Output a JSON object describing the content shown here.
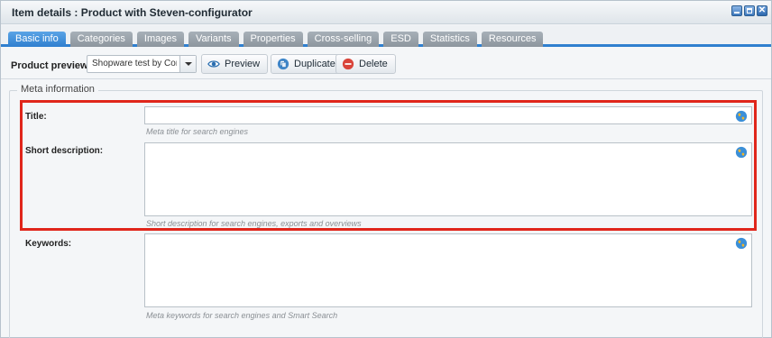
{
  "window": {
    "title": "Item details : Product with Steven-configurator",
    "buttons": [
      "minimize-button",
      "maximize-button",
      "close-button"
    ]
  },
  "tabs": [
    {
      "label": "Basic info",
      "active": true
    },
    {
      "label": "Categories",
      "active": false
    },
    {
      "label": "Images",
      "active": false
    },
    {
      "label": "Variants",
      "active": false
    },
    {
      "label": "Properties",
      "active": false
    },
    {
      "label": "Cross-selling",
      "active": false
    },
    {
      "label": "ESD",
      "active": false
    },
    {
      "label": "Statistics",
      "active": false
    },
    {
      "label": "Resources",
      "active": false
    }
  ],
  "toolbar": {
    "preview_label": "Product preview:",
    "shop_select_value": "Shopware test by Conte",
    "preview_button": "Preview",
    "duplicate_button": "Duplicate",
    "delete_button": "Delete"
  },
  "meta": {
    "legend": "Meta information",
    "fields": [
      {
        "label": "Title:",
        "value": "",
        "hint": "Meta title for search engines"
      },
      {
        "label": "Short description:",
        "value": "",
        "hint": "Short description for search engines, exports and overviews"
      },
      {
        "label": "Keywords:",
        "value": "",
        "hint": "Meta keywords for search engines and Smart Search"
      }
    ]
  },
  "colors": {
    "accent": "#2f7fcf",
    "highlight": "#e0261b"
  },
  "icons": {
    "preview": "eye-icon",
    "duplicate": "duplicate-icon",
    "delete": "delete-icon",
    "translate": "globe-icon"
  }
}
